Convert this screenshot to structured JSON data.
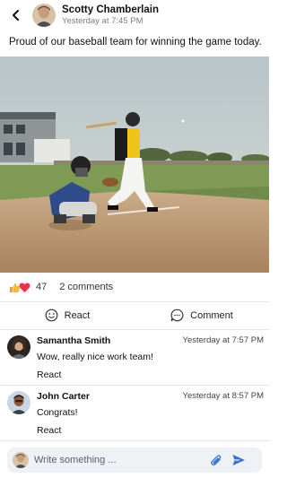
{
  "header": {
    "author": "Scotty Chamberlain",
    "timestamp": "Yesterday at 7:45 PM"
  },
  "post": {
    "text": "Proud of our baseball team for winning the game today.",
    "reactions_count": "47",
    "comments_count": "2 comments"
  },
  "actions": {
    "react_label": "React",
    "comment_label": "Comment"
  },
  "comments": [
    {
      "name": "Samantha Smith",
      "time": "Yesterday at 7:57 PM",
      "text": "Wow, really nice work team!",
      "react_label": "React"
    },
    {
      "name": "John Carter",
      "time": "Yesterday at 8:57 PM",
      "text": "Congrats!",
      "react_label": "React"
    }
  ],
  "composer": {
    "placeholder": "Write something ..."
  },
  "colors": {
    "accent": "#3b6fd4",
    "divider": "#e3e5e8",
    "heart": "#e8334a",
    "like": "#f6b93b"
  }
}
